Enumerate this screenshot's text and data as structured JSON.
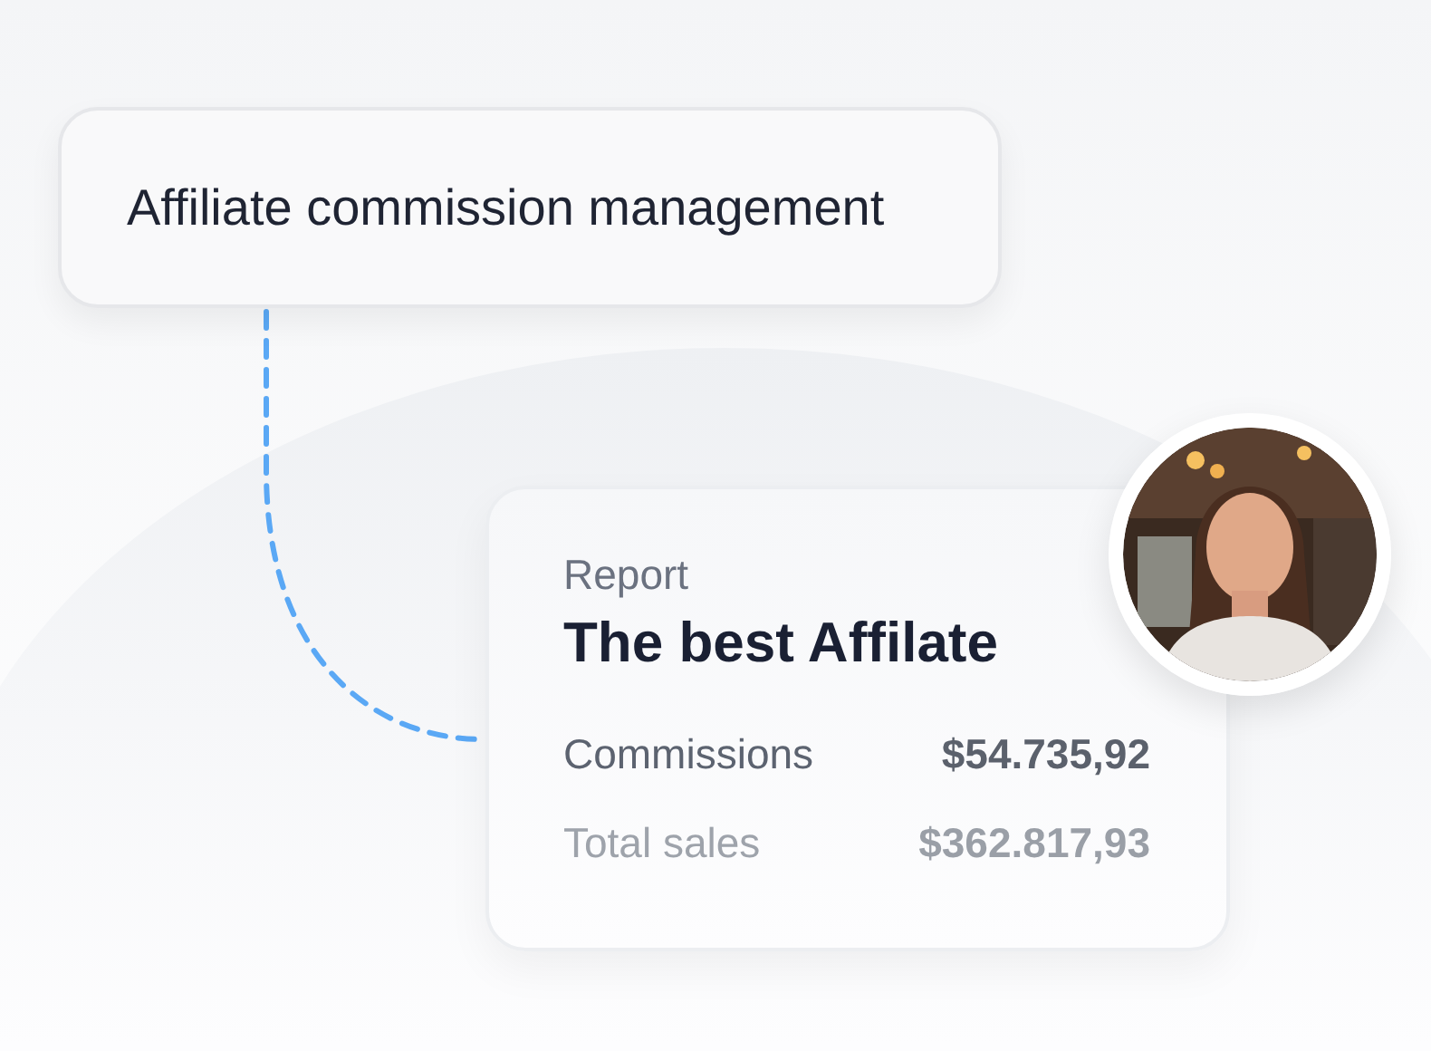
{
  "topic_card": {
    "title": "Affiliate commission management"
  },
  "report_card": {
    "label": "Report",
    "title": "The best Affilate",
    "rows": [
      {
        "kind": "primary",
        "name": "Commissions",
        "value": "$54.735,92"
      },
      {
        "kind": "secondary",
        "name": "Total sales",
        "value": "$362.817,93"
      }
    ]
  }
}
